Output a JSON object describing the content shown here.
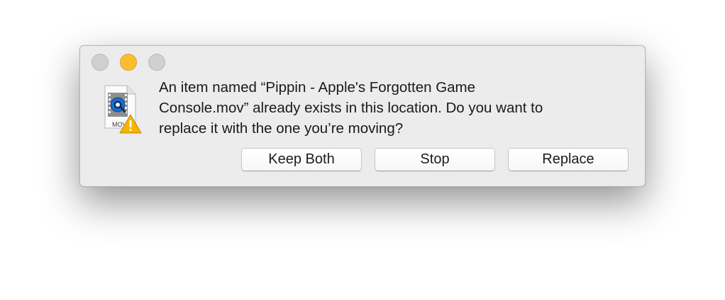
{
  "dialog": {
    "message": "An item named “Pippin - Apple's Forgotten Game\nConsole.mov” already exists in this location. Do you want to\nreplace it with the one you’re moving?",
    "file_icon": {
      "label": "MOV",
      "icon": "quicktime-movie-file-icon",
      "badge_icon": "warning-icon"
    },
    "buttons": {
      "keep_both": "Keep Both",
      "stop": "Stop",
      "replace": "Replace"
    },
    "window_controls": [
      "close",
      "minimize",
      "zoom"
    ]
  },
  "colors": {
    "dialog_background": "#ececec",
    "minimize_light": "#fdbc30",
    "inactive_light": "#d0d0d0",
    "warning": "#f5b400"
  }
}
